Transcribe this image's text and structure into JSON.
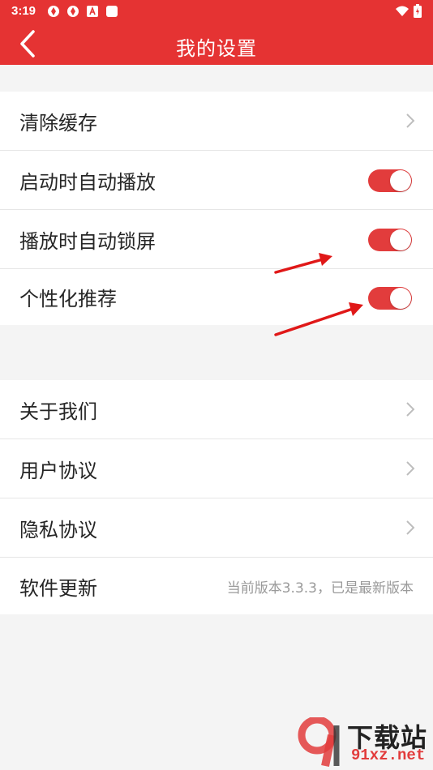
{
  "status_bar": {
    "time": "3:19"
  },
  "app_bar": {
    "title": "我的设置"
  },
  "settings_group_1": [
    {
      "label": "清除缓存",
      "control": "chevron"
    },
    {
      "label": "启动时自动播放",
      "control": "toggle",
      "on": true
    },
    {
      "label": "播放时自动锁屏",
      "control": "toggle",
      "on": true
    },
    {
      "label": "个性化推荐",
      "control": "toggle",
      "on": true
    }
  ],
  "settings_group_2": [
    {
      "label": "关于我们",
      "control": "chevron"
    },
    {
      "label": "用户协议",
      "control": "chevron"
    },
    {
      "label": "隐私协议",
      "control": "chevron"
    },
    {
      "label": "软件更新",
      "control": "text",
      "value": "当前版本3.3.3，已是最新版本"
    }
  ],
  "watermark": {
    "line1": "下载站",
    "line2": "91xz.net",
    "logo": "9"
  },
  "colors": {
    "accent": "#e53333",
    "toggle_on": "#e23c3c",
    "background": "#f4f4f4"
  }
}
